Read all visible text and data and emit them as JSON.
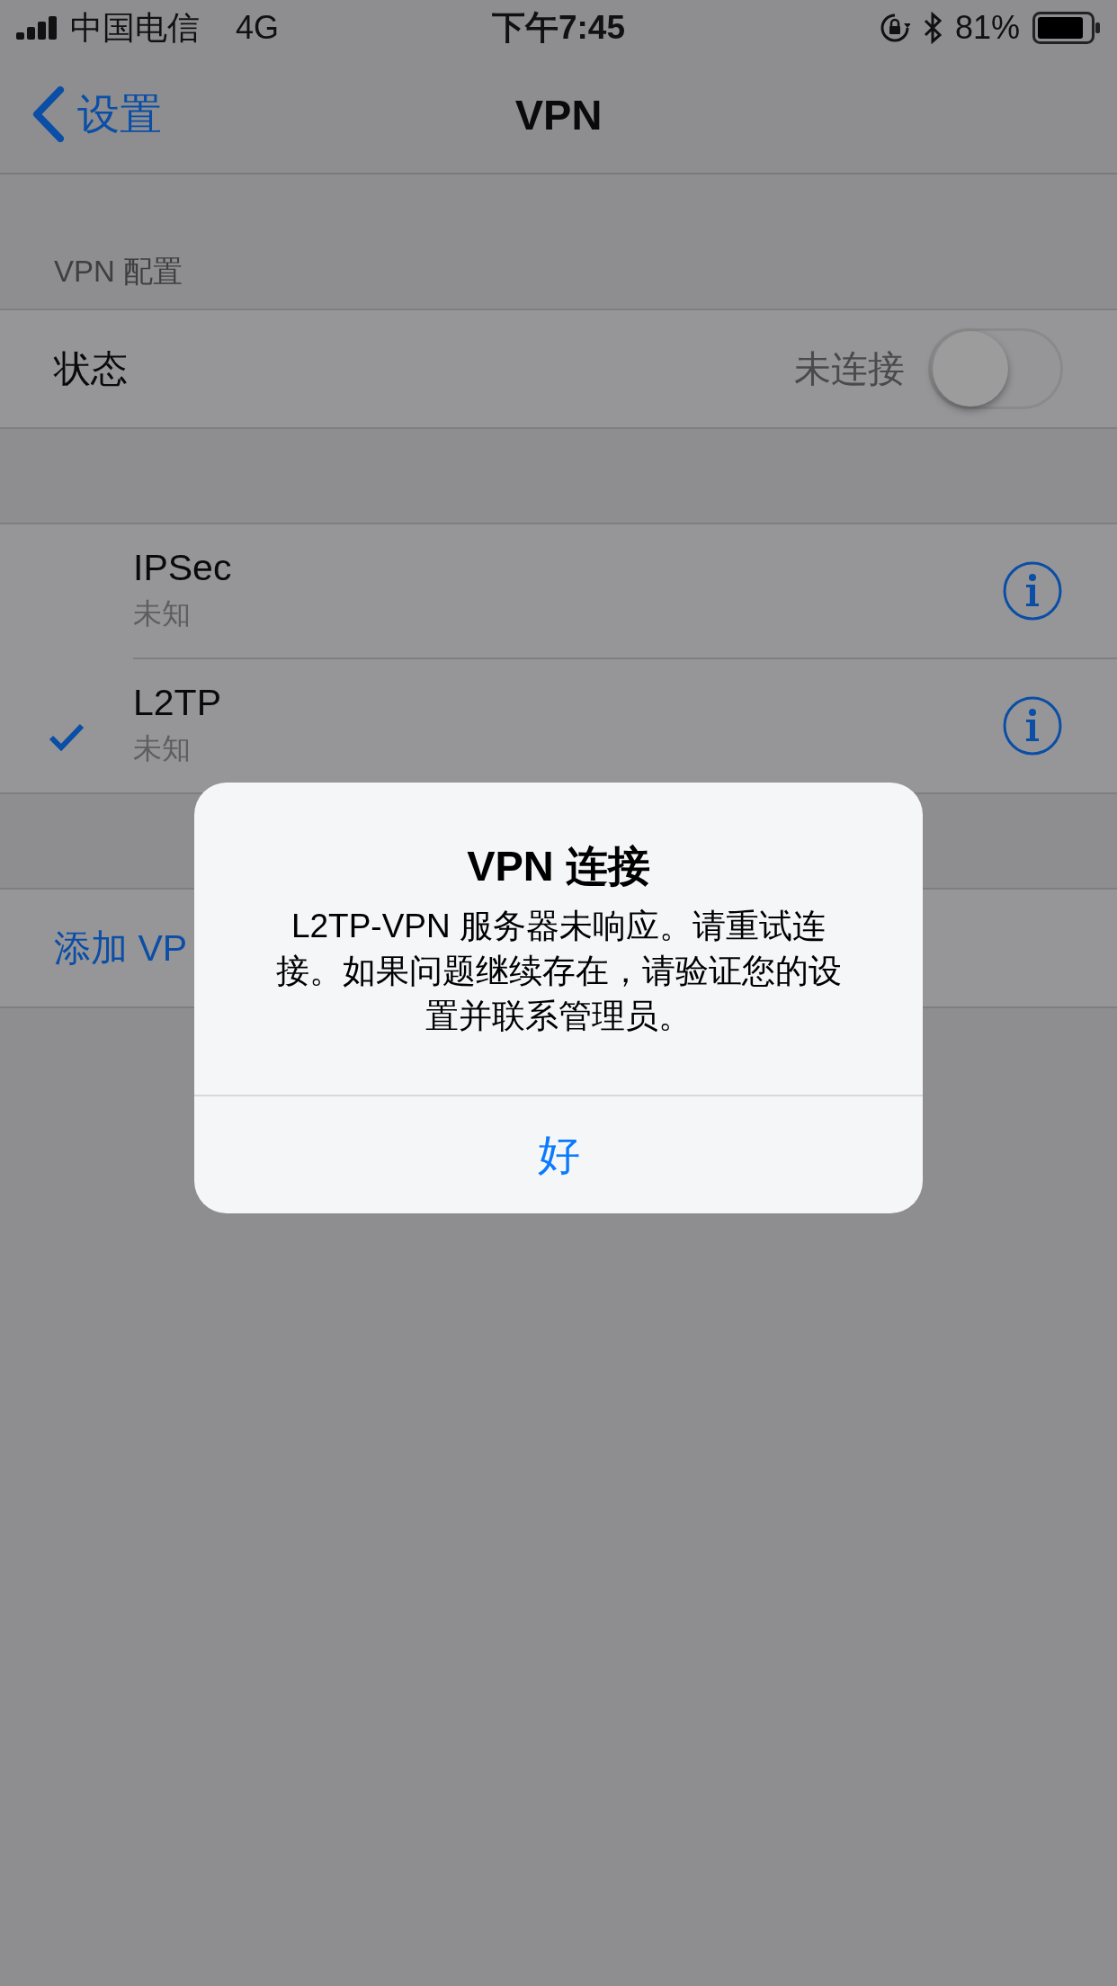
{
  "status_bar": {
    "carrier": "中国电信",
    "network": "4G",
    "time": "下午7:45",
    "battery": "81%"
  },
  "nav": {
    "back": "设置",
    "title": "VPN"
  },
  "section_header": "VPN 配置",
  "status_row": {
    "label": "状态",
    "value": "未连接",
    "on": false
  },
  "vpn_configs": [
    {
      "name": "IPSec",
      "status": "未知",
      "selected": false
    },
    {
      "name": "L2TP",
      "status": "未知",
      "selected": true
    }
  ],
  "add_row": {
    "label": "添加 VP"
  },
  "alert": {
    "title": "VPN 连接",
    "message": "L2TP-VPN 服务器未响应。请重试连接。如果问题继续存在，请验证您的设置并联系管理员。",
    "button": "好"
  }
}
